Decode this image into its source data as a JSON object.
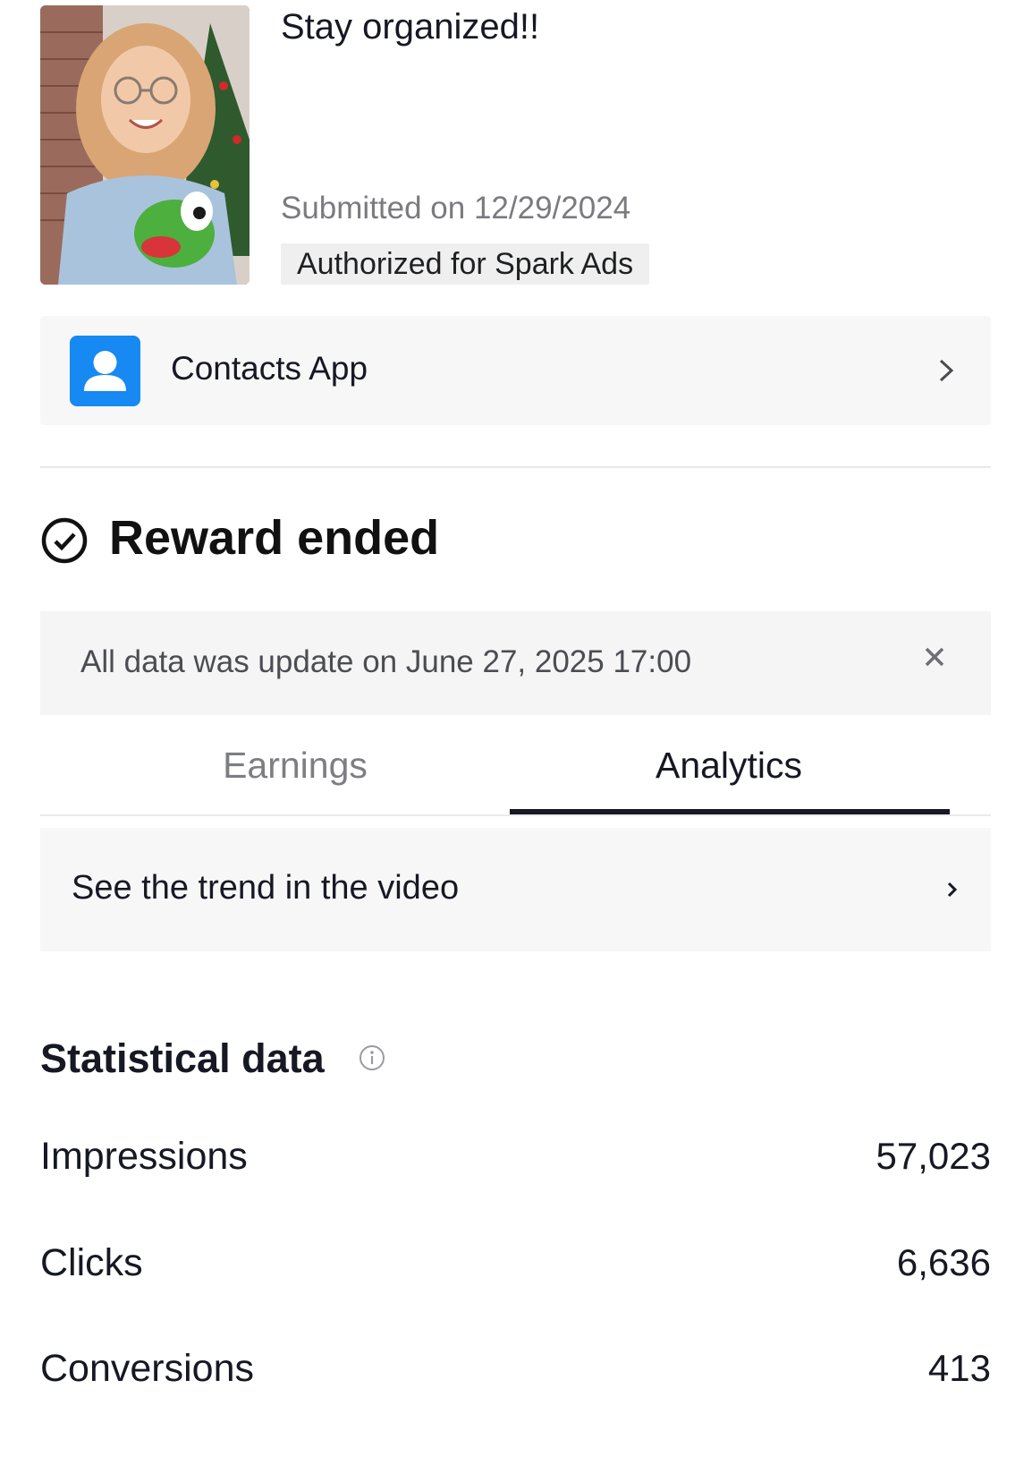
{
  "video": {
    "title": "Stay organized!!",
    "submitted": "Submitted on 12/29/2024",
    "badge": "Authorized for Spark Ads",
    "thumbnail_icon": "video-thumbnail"
  },
  "app": {
    "name": "Contacts App",
    "icon": "contacts-app-icon",
    "icon_color": "#1689f2"
  },
  "reward": {
    "status": "Reward ended",
    "icon": "check-circle-icon"
  },
  "notice": {
    "text": "All data was update on June 27, 2025 17:00",
    "close_icon": "close-icon"
  },
  "tabs": [
    {
      "label": "Earnings",
      "active": false
    },
    {
      "label": "Analytics",
      "active": true
    }
  ],
  "trend": {
    "label": "See the trend in the video"
  },
  "stats": {
    "title": "Statistical data",
    "info_icon": "info-icon",
    "rows": [
      {
        "label": "Impressions",
        "value": "57,023"
      },
      {
        "label": "Clicks",
        "value": "6,636"
      },
      {
        "label": "Conversions",
        "value": "413"
      }
    ]
  }
}
